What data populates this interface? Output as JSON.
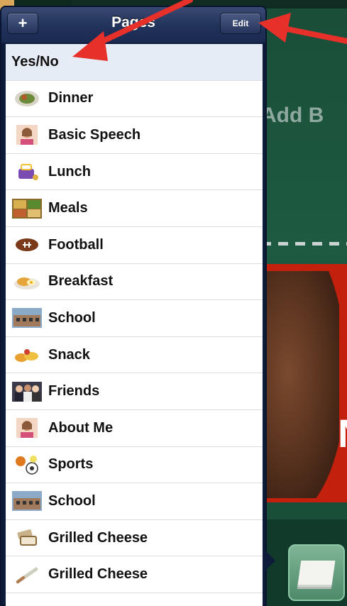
{
  "background": {
    "add_text": "Add B",
    "red_card_letter": "N"
  },
  "nav": {
    "title": "Pages",
    "add_label": "+",
    "edit_label": "Edit"
  },
  "rows": [
    {
      "label": "Yes/No",
      "icon": "none",
      "selected": true
    },
    {
      "label": "Dinner",
      "icon": "dinner-plate-icon"
    },
    {
      "label": "Basic Speech",
      "icon": "person-photo-icon"
    },
    {
      "label": "Lunch",
      "icon": "lunchbox-icon"
    },
    {
      "label": "Meals",
      "icon": "meals-photo-icon"
    },
    {
      "label": "Football",
      "icon": "football-icon"
    },
    {
      "label": "Breakfast",
      "icon": "breakfast-icon"
    },
    {
      "label": "School",
      "icon": "school-building-icon"
    },
    {
      "label": "Snack",
      "icon": "snack-icon"
    },
    {
      "label": "Friends",
      "icon": "friends-photo-icon"
    },
    {
      "label": "About Me",
      "icon": "person-photo-icon"
    },
    {
      "label": "Sports",
      "icon": "sports-balls-icon"
    },
    {
      "label": "School",
      "icon": "school-building-icon"
    },
    {
      "label": "Grilled Cheese",
      "icon": "sandwich-icon"
    },
    {
      "label": "Grilled Cheese",
      "icon": "knife-icon"
    }
  ],
  "colors": {
    "nav_bar": "#22335c",
    "annotation_arrow": "#e8302a",
    "background_green": "#1d5a41",
    "card_red": "#c4200e"
  }
}
